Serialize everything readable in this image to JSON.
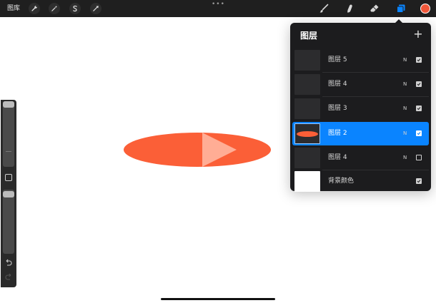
{
  "topbar": {
    "gallery_label": "图库",
    "handle": "•••",
    "left_tools": [
      "wrench-icon",
      "magic-wand-icon",
      "selection-s-icon",
      "transform-arrow-icon"
    ],
    "right_tools": [
      "brush-icon",
      "smudge-icon",
      "eraser-icon",
      "layers-icon"
    ],
    "current_color": "#f0583a",
    "active_tool_color": "#0a84ff"
  },
  "sidebar": {
    "brush_size": 1.0,
    "opacity": 0.97
  },
  "layers_panel": {
    "title": "图层",
    "add_label": "+",
    "layers": [
      {
        "name": "图层 5",
        "blend": "N",
        "visible": true,
        "selected": false
      },
      {
        "name": "图层 4",
        "blend": "N",
        "visible": true,
        "selected": false
      },
      {
        "name": "图层 3",
        "blend": "N",
        "visible": true,
        "selected": false
      },
      {
        "name": "图层 2",
        "blend": "N",
        "visible": true,
        "selected": true
      },
      {
        "name": "图层 4",
        "blend": "N",
        "visible": false,
        "selected": false
      }
    ],
    "background": {
      "name": "背景颜色",
      "visible": true,
      "color": "#ffffff"
    }
  },
  "colors": {
    "ellipse": "#fb5f37",
    "triangle": "#ffad95",
    "accent": "#0a84ff"
  }
}
